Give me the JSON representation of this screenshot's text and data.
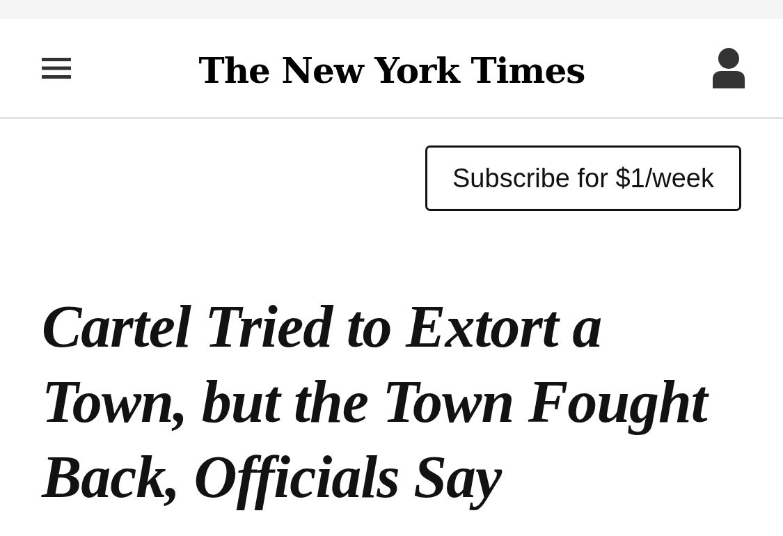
{
  "header": {
    "logo": "The New York Times"
  },
  "subscribe_button": {
    "label": "Subscribe for $1/week"
  },
  "article": {
    "headline": "Cartel Tried to Extort a Town, but the Town Fought Back, Officials Say"
  }
}
